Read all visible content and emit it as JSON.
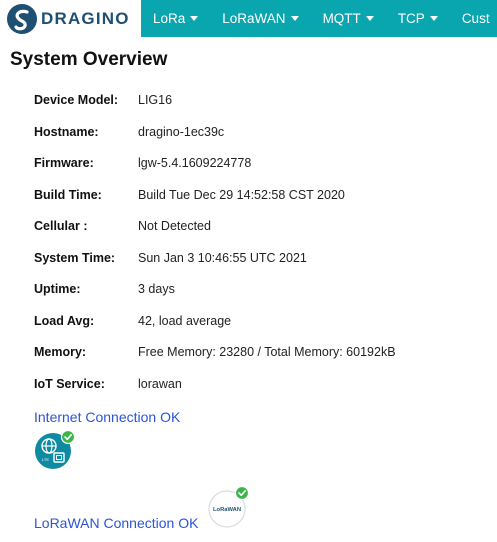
{
  "navbar": {
    "logo_text": "DRAGINO",
    "items": [
      {
        "label": "LoRa"
      },
      {
        "label": "LoRaWAN"
      },
      {
        "label": "MQTT"
      },
      {
        "label": "TCP"
      },
      {
        "label": "Cust"
      }
    ],
    "colors": {
      "bar": "#0aa6b0",
      "logo": "#1f4f73"
    }
  },
  "page": {
    "title": "System Overview"
  },
  "overview": {
    "rows": [
      {
        "key": "Device Model:",
        "value": "LIG16"
      },
      {
        "key": "Hostname:",
        "value": "dragino-1ec39c"
      },
      {
        "key": "Firmware:",
        "value": "lgw-5.4.1609224778"
      },
      {
        "key": "Build Time:",
        "value": "Build Tue Dec 29 14:52:58 CST 2020"
      },
      {
        "key": "Cellular :",
        "value": "Not Detected"
      },
      {
        "key": "System Time:",
        "value": "Sun Jan 3 10:46:55 UTC 2021"
      },
      {
        "key": "Uptime:",
        "value": "3 days"
      },
      {
        "key": "Load Avg:",
        "value": "42, load average"
      },
      {
        "key": "Memory:",
        "value": "Free Memory: 23280 / Total Memory: 60192kB"
      },
      {
        "key": "IoT Service:",
        "value": "lorawan"
      }
    ]
  },
  "connections": {
    "internet": {
      "label": "Internet Connection OK",
      "icon": "globe-router-icon",
      "status_color": "#3bb54a"
    },
    "lorawan": {
      "label": "LoRaWAN Connection OK",
      "icon": "lorawan-icon",
      "icon_text": "LoRaWAN",
      "status_color": "#3bb54a"
    }
  }
}
